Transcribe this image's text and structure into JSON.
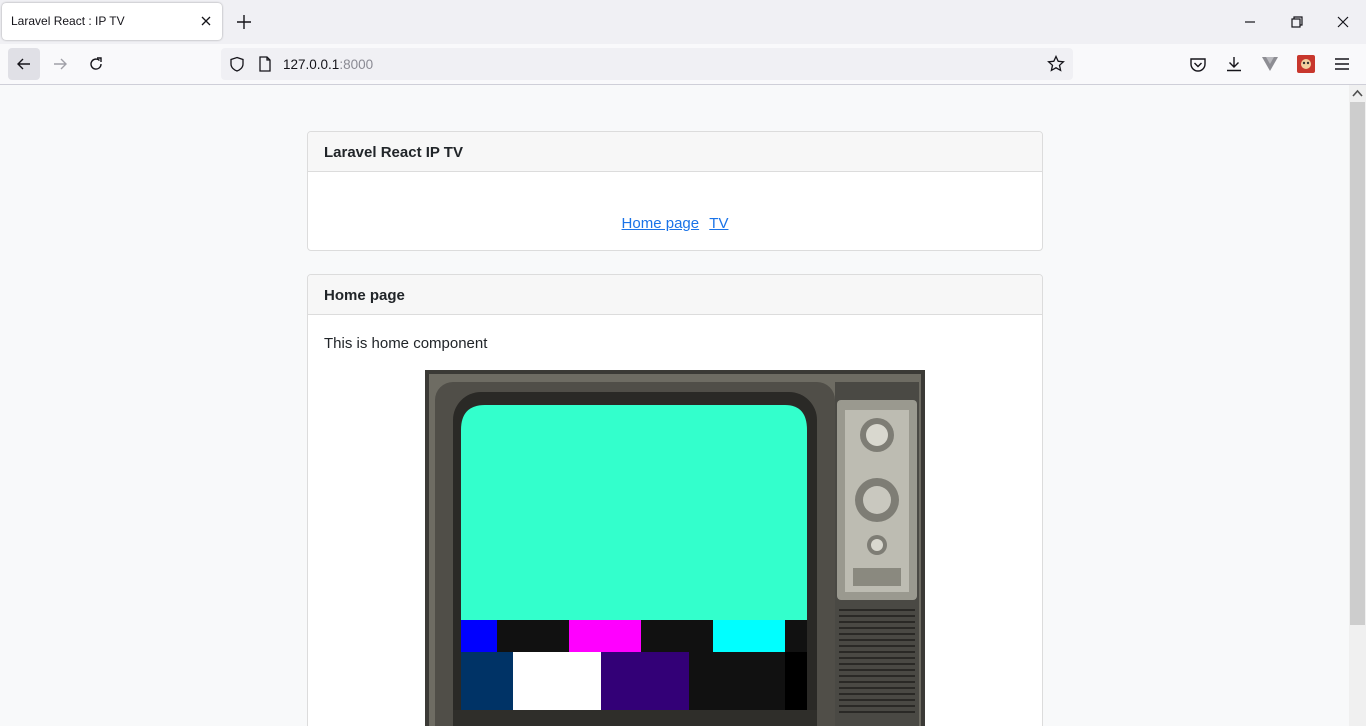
{
  "browser": {
    "tab_title": "Laravel React : IP TV",
    "url_host": "127.0.0.1",
    "url_port": ":8000"
  },
  "nav_card": {
    "title": "Laravel React IP TV",
    "links": [
      "Home page",
      "TV"
    ]
  },
  "home_card": {
    "title": "Home page",
    "text": "This is home component"
  },
  "colors": {
    "link": "#1a73e8",
    "tv_screen": "#33ffcc",
    "bar_blue": "#0000ff",
    "bar_magenta": "#ff00ff",
    "bar_cyan": "#00ffff",
    "bar_navy": "#003366",
    "bar_purple": "#330077"
  },
  "icons": [
    "close-icon",
    "plus-icon",
    "minimize-icon",
    "restore-icon",
    "back-icon",
    "forward-icon",
    "reload-icon",
    "shield-icon",
    "page-icon",
    "star-icon",
    "pocket-icon",
    "download-icon",
    "vpn-icon",
    "extension-icon",
    "menu-icon"
  ]
}
